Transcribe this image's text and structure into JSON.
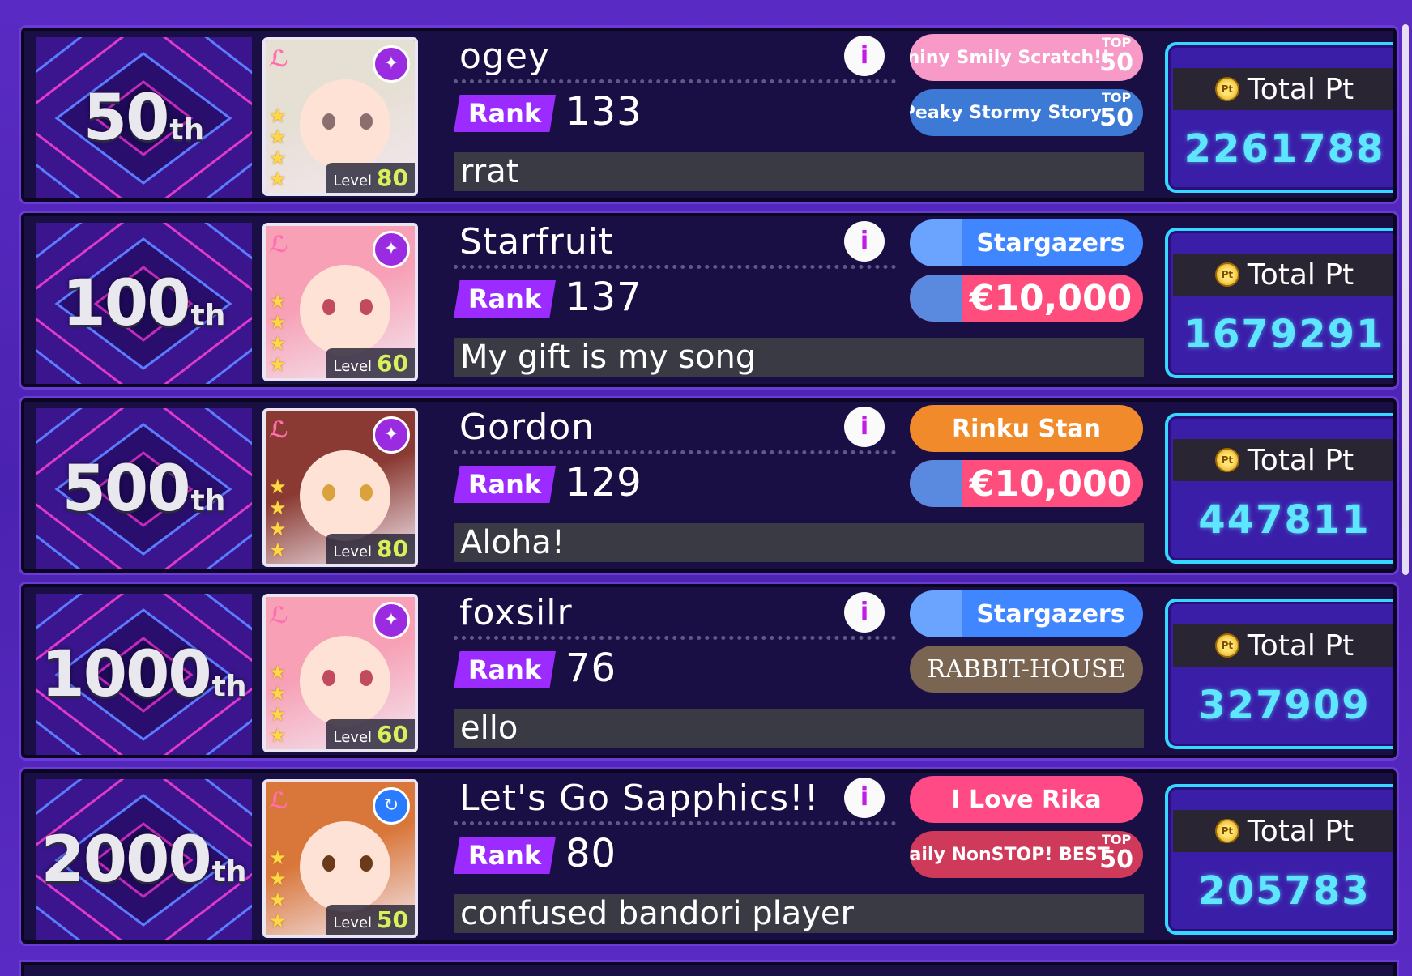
{
  "rows": [
    {
      "place": "50",
      "suffix": "th",
      "card": {
        "level_label": "Level",
        "level": "80",
        "hair": "#e6dfd4",
        "eye": "#8b6e6e",
        "attr_icon": "shoe-icon"
      },
      "name": "ogey",
      "rank_label": "Rank",
      "rank": "133",
      "comment": "rrat",
      "badges": [
        {
          "text": "Shiny Smily Scratch!!",
          "top_label": "TOP",
          "top_value": "50",
          "bg": "#f79ac7"
        },
        {
          "text": "Peaky Stormy Story",
          "top_label": "TOP",
          "top_value": "50",
          "bg": "#3c7ad6"
        }
      ],
      "total_label": "Total Pt",
      "total": "2261788"
    },
    {
      "place": "100",
      "suffix": "th",
      "card": {
        "level_label": "Level",
        "level": "60",
        "hair": "#f7a0b6",
        "eye": "#c24a5e",
        "attr_icon": "shoe-icon"
      },
      "name": "Starfruit",
      "rank_label": "Rank",
      "rank": "137",
      "comment": "My gift is my song",
      "badges": [
        {
          "text": "Stargazers",
          "top_label": "",
          "top_value": "",
          "bg": "#3f86ff"
        },
        {
          "text": "€10,000",
          "top_label": "",
          "top_value": "",
          "bg": "#ff4d7d"
        }
      ],
      "total_label": "Total Pt",
      "total": "1679291"
    },
    {
      "place": "500",
      "suffix": "th",
      "card": {
        "level_label": "Level",
        "level": "80",
        "hair": "#8a3a32",
        "eye": "#d9a23a",
        "attr_icon": "shoe-icon"
      },
      "name": "Gordon",
      "rank_label": "Rank",
      "rank": "129",
      "comment": "Aloha!",
      "badges": [
        {
          "text": "Rinku Stan",
          "top_label": "",
          "top_value": "",
          "bg": "#f08a2a"
        },
        {
          "text": "€10,000",
          "top_label": "",
          "top_value": "",
          "bg": "#ff4d7d"
        }
      ],
      "total_label": "Total Pt",
      "total": "447811"
    },
    {
      "place": "1000",
      "suffix": "th",
      "card": {
        "level_label": "Level",
        "level": "60",
        "hair": "#f7a0b6",
        "eye": "#c24a5e",
        "attr_icon": "shoe-icon"
      },
      "name": "foxsilr",
      "rank_label": "Rank",
      "rank": "76",
      "comment": "ello",
      "badges": [
        {
          "text": "Stargazers",
          "top_label": "",
          "top_value": "",
          "bg": "#3f86ff"
        },
        {
          "text": "RABBIT-HOUSE",
          "top_label": "",
          "top_value": "",
          "bg": "#7a6552"
        }
      ],
      "total_label": "Total Pt",
      "total": "327909"
    },
    {
      "place": "2000",
      "suffix": "th",
      "card": {
        "level_label": "Level",
        "level": "50",
        "hair": "#d9763a",
        "eye": "#6a3a1a",
        "attr_icon": "swirl-icon"
      },
      "name": "Let's Go Sapphics!!",
      "rank_label": "Rank",
      "rank": "80",
      "comment": "confused bandori player",
      "badges": [
        {
          "text": "I Love Rika",
          "top_label": "",
          "top_value": "",
          "bg": "#ff4a86"
        },
        {
          "text": "Daily NonSTOP! BEST",
          "top_label": "TOP",
          "top_value": "50",
          "bg": "#d03a5a"
        }
      ],
      "total_label": "Total Pt",
      "total": "205783"
    }
  ],
  "colors": {
    "background": "#4a22b0",
    "row_bg": "#1a0f45",
    "rank_badge": "#9b2bff",
    "total_value": "#5ee6ff",
    "total_border": "#35d8ff"
  }
}
